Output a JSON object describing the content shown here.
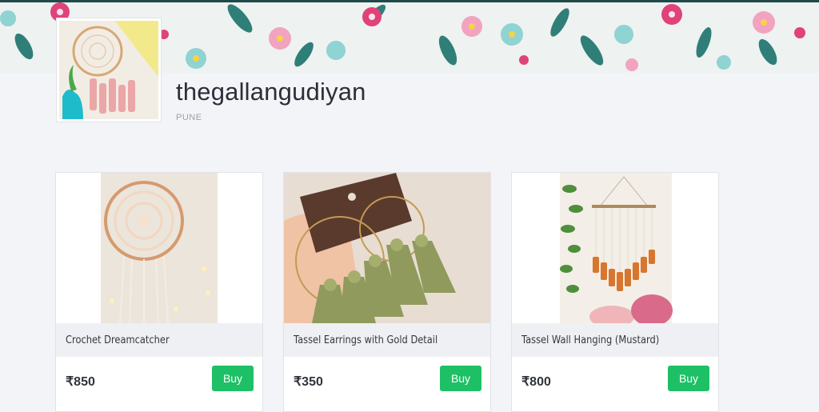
{
  "shop": {
    "name": "thegallangudiyan",
    "location": "PUNE"
  },
  "colors": {
    "accent": "#1ec066",
    "banner_dark": "#1f4a4a",
    "page_bg": "#f3f4f8"
  },
  "products": [
    {
      "title": "Crochet Dreamcatcher",
      "price": "₹850",
      "buy_label": "Buy"
    },
    {
      "title": "Tassel Earrings with Gold Detail",
      "price": "₹350",
      "buy_label": "Buy"
    },
    {
      "title": "Tassel Wall Hanging (Mustard)",
      "price": "₹800",
      "buy_label": "Buy"
    }
  ]
}
